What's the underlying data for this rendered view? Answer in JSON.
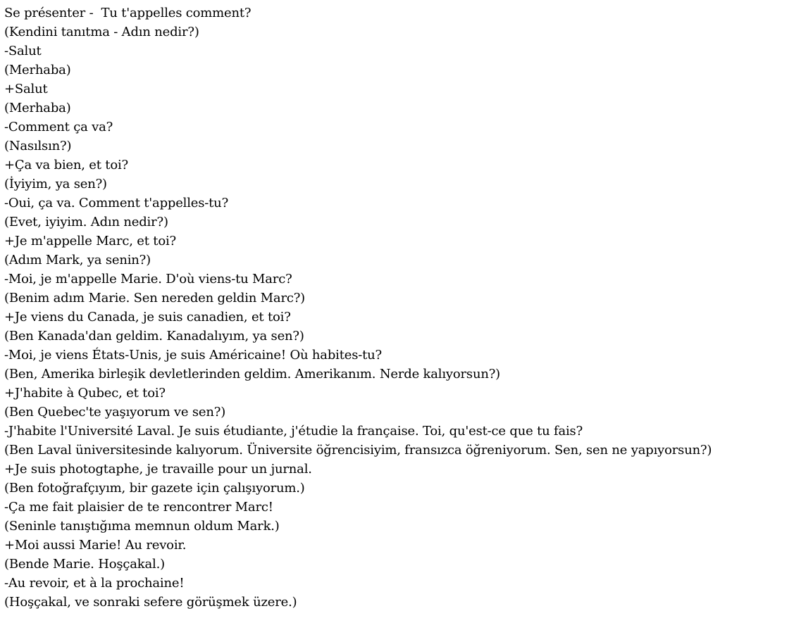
{
  "document": {
    "lines": [
      "Se présenter -  Tu t'appelles comment?",
      "(Kendini tanıtma - Adın nedir?)",
      "-Salut",
      "(Merhaba)",
      "+Salut",
      "(Merhaba)",
      "-Comment ça va?",
      "(Nasılsın?)",
      "+Ça va bien, et toi?",
      "(İyiyim, ya sen?)",
      "-Oui, ça va. Comment t'appelles-tu?",
      "(Evet, iyiyim. Adın nedir?)",
      "+Je m'appelle Marc, et toi?",
      "(Adım Mark, ya senin?)",
      "-Moi, je m'appelle Marie. D'où viens-tu Marc?",
      "(Benim adım Marie. Sen nereden geldin Marc?)",
      "+Je viens du Canada, je suis canadien, et toi?",
      "(Ben Kanada'dan geldim. Kanadalıyım, ya sen?)",
      "-Moi, je viens États-Unis, je suis Américaine! Où habites-tu?",
      "(Ben, Amerika birleşik devletlerinden geldim. Amerikanım. Nerde kalıyorsun?)",
      "+J'habite à Qubec, et toi?",
      "(Ben Quebec'te yaşıyorum ve sen?)",
      "-J'habite l'Université Laval. Je suis étudiante, j'étudie la française. Toi, qu'est-ce que tu fais?",
      "(Ben Laval üniversitesinde kalıyorum. Üniversite öğrencisiyim, fransızca öğreniyorum. Sen, sen ne yapıyorsun?)",
      "+Je suis photogtaphe, je travaille pour un jurnal.",
      "(Ben fotoğrafçıyım, bir gazete için çalışıyorum.)",
      "-Ça me fait plaisier de te rencontrer Marc!",
      "(Seninle tanıştığıma memnun oldum Mark.)",
      "+Moi aussi Marie! Au revoir.",
      "(Bende Marie. Hoşçakal.)",
      "-Au revoir, et à la prochaine!",
      "(Hoşçakal, ve sonraki sefere görüşmek üzere.)"
    ]
  }
}
